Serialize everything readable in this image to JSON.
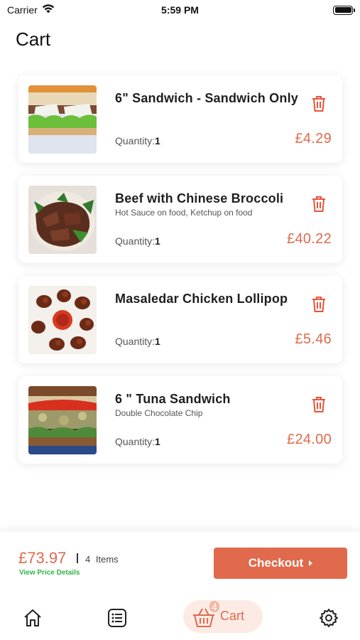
{
  "status_bar": {
    "carrier": "Carrier",
    "time": "5:59 PM"
  },
  "page": {
    "title": "Cart"
  },
  "cart": {
    "quantity_label": "Quantity:",
    "items": [
      {
        "name": "6\" Sandwich - Sandwich Only",
        "note": "",
        "quantity": "1",
        "price": "£4.29",
        "image": "sandwich"
      },
      {
        "name": "Beef with Chinese Broccoli",
        "note": "Hot Sauce on food, Ketchup on food",
        "quantity": "1",
        "price": "£40.22",
        "image": "beef-broccoli"
      },
      {
        "name": "Masaledar Chicken Lollipop",
        "note": "",
        "quantity": "1",
        "price": "£5.46",
        "image": "chicken-lollipop"
      },
      {
        "name": "6 \" Tuna Sandwich",
        "note": "Double Chocolate Chip",
        "quantity": "1",
        "price": "£24.00",
        "image": "tuna-sandwich"
      }
    ]
  },
  "summary": {
    "total": "£73.97",
    "item_count": "4",
    "items_label": "Items",
    "view_details": "View Price Details",
    "checkout_label": "Checkout"
  },
  "tab_bar": {
    "cart_badge": "4",
    "cart_label": "Cart"
  },
  "colors": {
    "accent": "#e06a4b",
    "accent_light": "#fcebe5",
    "success": "#32b24a"
  }
}
